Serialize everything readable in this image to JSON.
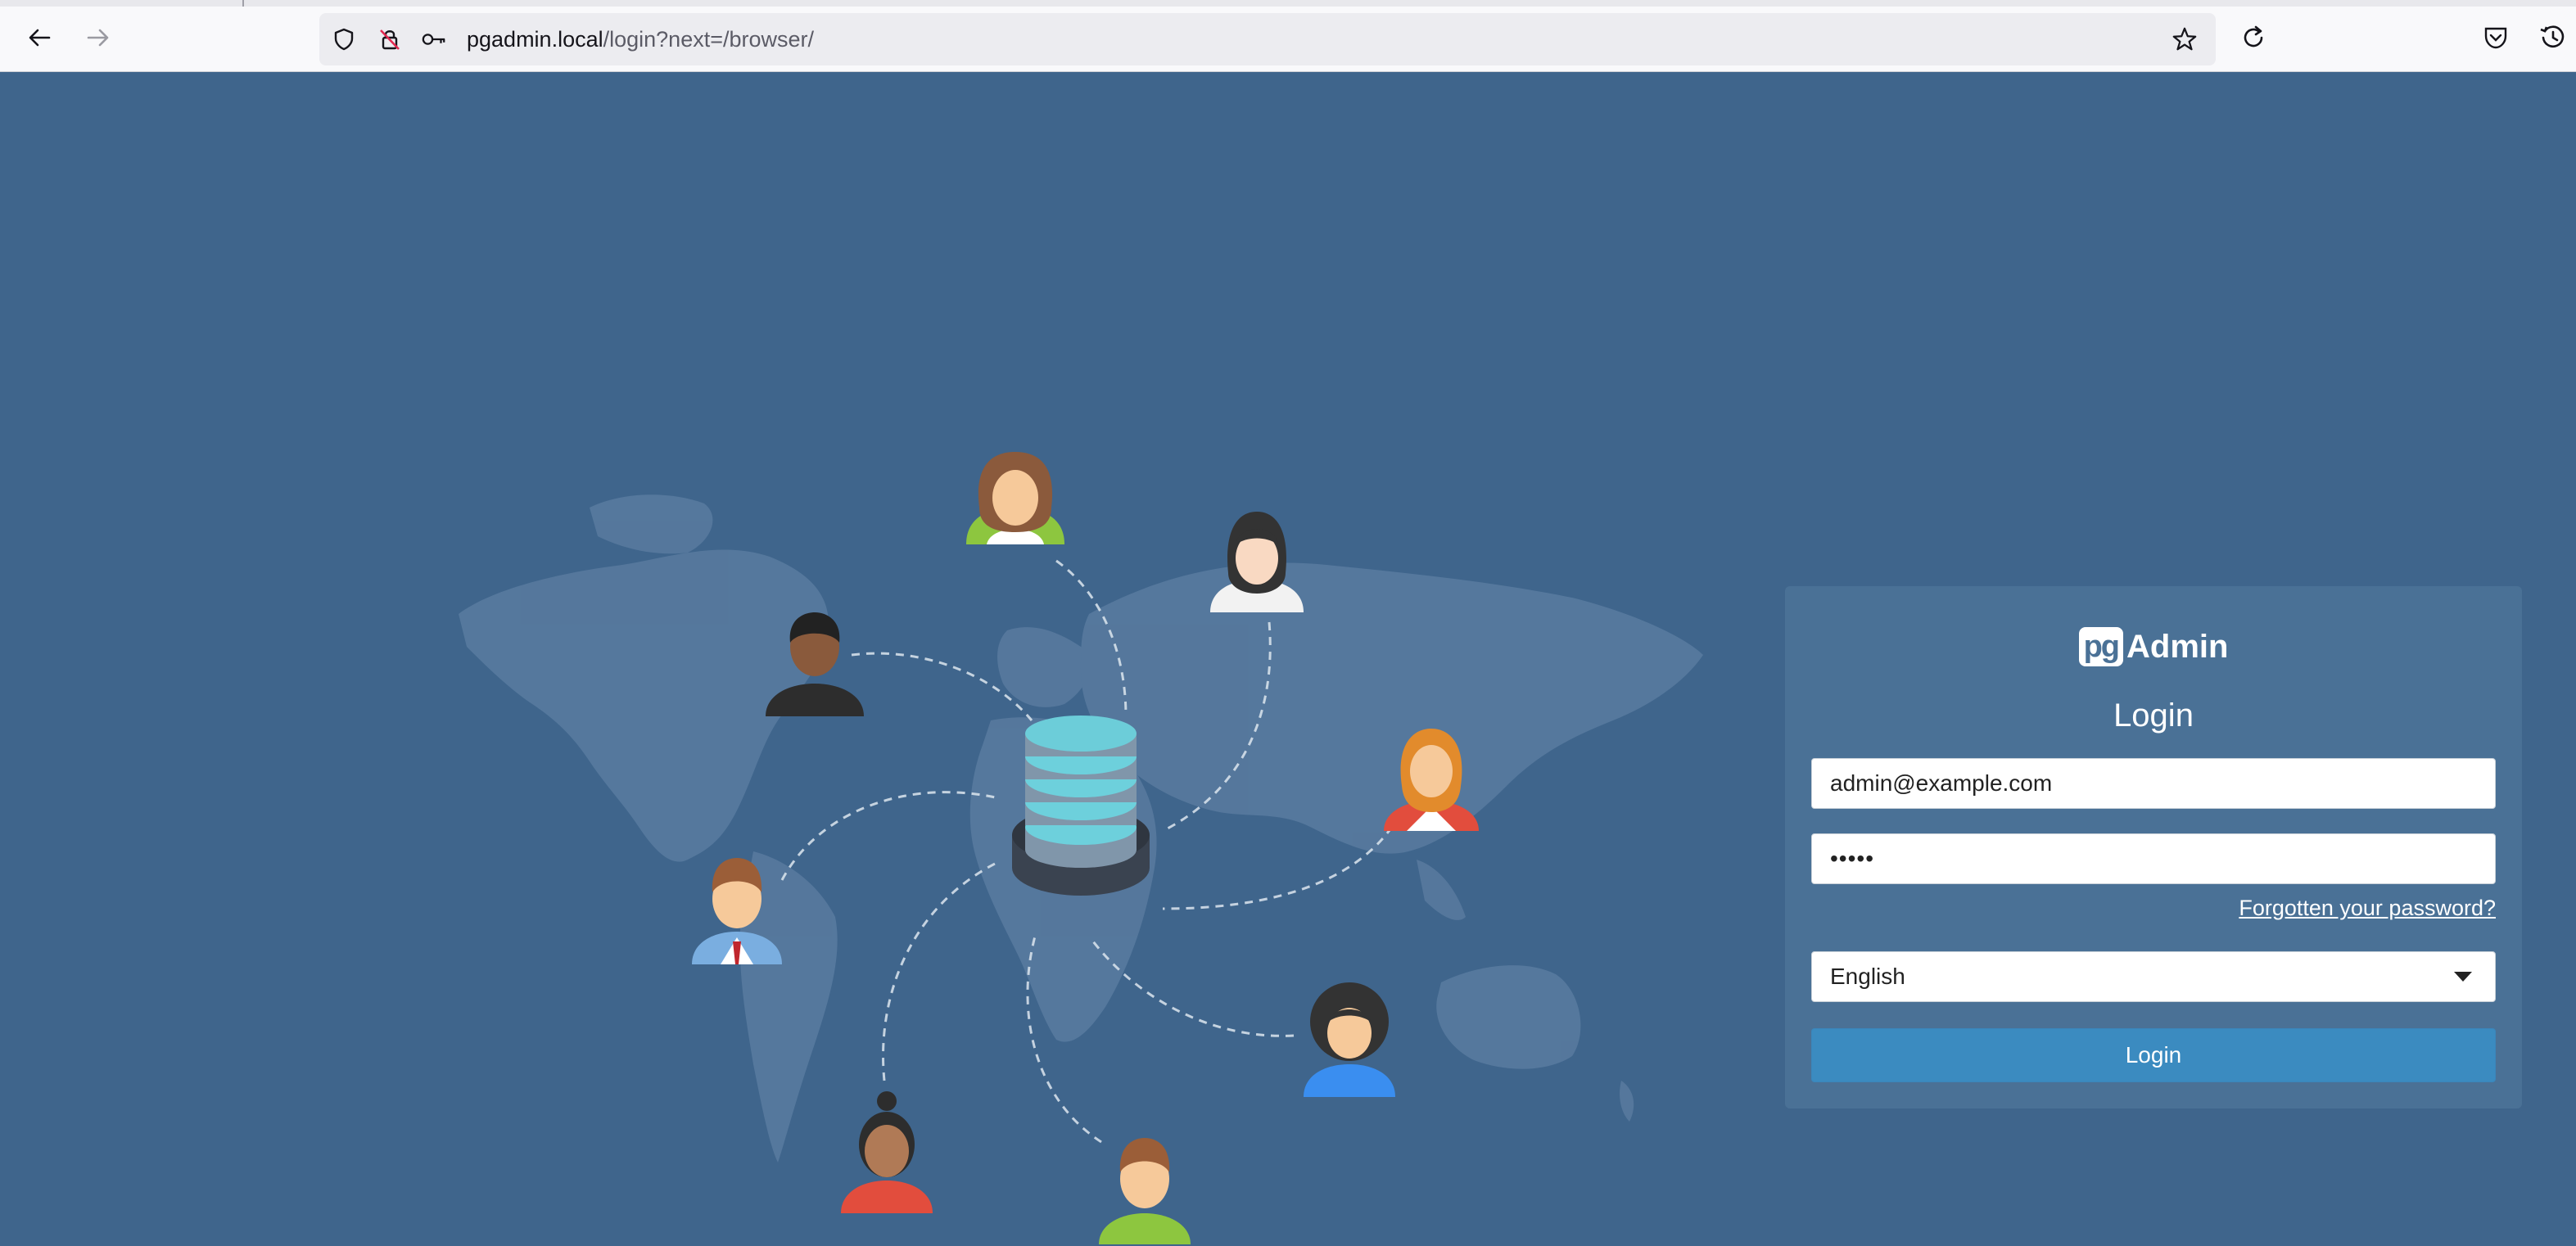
{
  "browser": {
    "url_host": "pgadmin.local",
    "url_path": "/login?next=/browser/"
  },
  "login": {
    "logo_box": "pg",
    "logo_text": "Admin",
    "title": "Login",
    "email_value": "admin@example.com",
    "password_value": "•••••",
    "forgot_label": "Forgotten your password?",
    "language": "English",
    "login_button": "Login"
  },
  "colors": {
    "background": "#3f658c",
    "panel": "#4a7196",
    "button": "#3b8bc0"
  }
}
